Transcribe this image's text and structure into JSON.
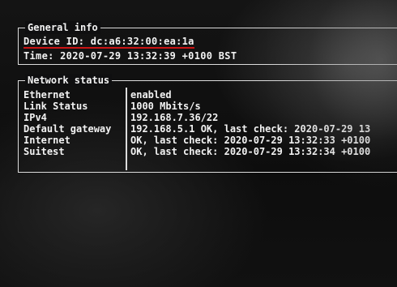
{
  "general_info": {
    "title": "General info",
    "device_id": "Device ID: dc:a6:32:00:ea:1a",
    "time": "Time: 2020-07-29 13:32:39 +0100 BST"
  },
  "network_status": {
    "title": "Network status",
    "rows": [
      {
        "label": "Ethernet",
        "value": "enabled"
      },
      {
        "label": "Link Status",
        "value": "1000 Mbits/s"
      },
      {
        "label": "IPv4",
        "value": "192.168.7.36/22"
      },
      {
        "label": "Default gateway",
        "value": "192.168.5.1 OK, last check: 2020-07-29 13"
      },
      {
        "label": "Internet",
        "value": "OK, last check: 2020-07-29 13:32:33 +0100"
      },
      {
        "label": "Suitest",
        "value": "OK, last check: 2020-07-29 13:32:34 +0100"
      }
    ]
  },
  "colors": {
    "text": "#f2f2f2",
    "underline": "#c91414",
    "background": "#0c0c0d"
  }
}
